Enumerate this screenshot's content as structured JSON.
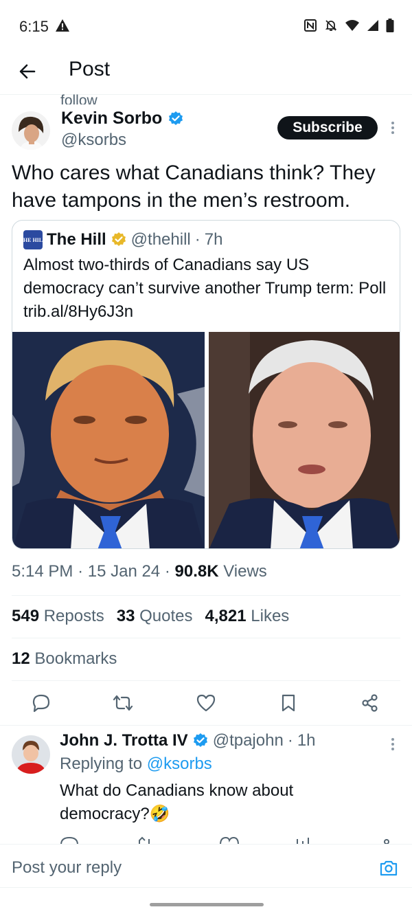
{
  "status_bar": {
    "time": "6:15"
  },
  "header": {
    "title": "Post"
  },
  "post": {
    "context_label": "follow",
    "author_name": "Kevin Sorbo",
    "author_handle": "@ksorbs",
    "subscribe_label": "Subscribe",
    "text": "Who cares what Canadians think? They have tampons in the men’s restroom.",
    "quote": {
      "author_name": "The Hill",
      "logo_text": "THE HILL",
      "author_handle": "@thehill",
      "separator": "·",
      "age": "7h",
      "text": "Almost two-thirds of Canadians say US democracy can’t survive another Trump term: Poll trib.al/8Hy6J3n"
    },
    "time": "5:14 PM",
    "date": "15 Jan 24",
    "views_count": "90.8K",
    "views_label": "Views",
    "reposts_count": "549",
    "reposts_label": "Reposts",
    "quotes_count": "33",
    "quotes_label": "Quotes",
    "likes_count": "4,821",
    "likes_label": "Likes",
    "bookmarks_count": "12",
    "bookmarks_label": "Bookmarks"
  },
  "reply": {
    "author_name": "John J. Trotta IV",
    "author_handle": "@tpajohn",
    "age": "1h",
    "replying_prefix": "Replying to",
    "replying_handle": "@ksorbs",
    "text": "What do Canadians know about democracy?🤣"
  },
  "composer": {
    "placeholder": "Post your reply"
  },
  "colors": {
    "accent": "#1d9bf0",
    "text": "#0f1419",
    "secondary": "#536471",
    "hill_blue": "#2b4aa0",
    "gold": "#e8b829"
  }
}
